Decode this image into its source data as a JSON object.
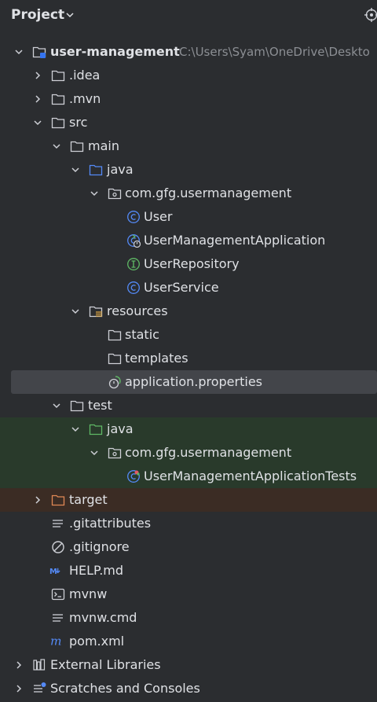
{
  "header": {
    "title": "Project"
  },
  "tree": [
    {
      "label": "user-management",
      "path": "C:\\Users\\Syam\\OneDrive\\Deskto",
      "icon": "module-folder-icon",
      "expanded": true
    },
    {
      "label": ".idea",
      "icon": "folder-icon",
      "expanded": false
    },
    {
      "label": ".mvn",
      "icon": "folder-icon",
      "expanded": false
    },
    {
      "label": "src",
      "icon": "folder-icon",
      "expanded": true
    },
    {
      "label": "main",
      "icon": "folder-icon",
      "expanded": true
    },
    {
      "label": "java",
      "icon": "source-folder-icon",
      "expanded": true
    },
    {
      "label": "com.gfg.usermanagement",
      "icon": "package-icon",
      "expanded": true
    },
    {
      "label": "User",
      "icon": "class-icon"
    },
    {
      "label": "UserManagementApplication",
      "icon": "spring-boot-class-icon"
    },
    {
      "label": "UserRepository",
      "icon": "interface-icon"
    },
    {
      "label": "UserService",
      "icon": "class-icon"
    },
    {
      "label": "resources",
      "icon": "resources-folder-icon",
      "expanded": true
    },
    {
      "label": "static",
      "icon": "folder-icon"
    },
    {
      "label": "templates",
      "icon": "folder-icon"
    },
    {
      "label": "application.properties",
      "icon": "spring-properties-icon"
    },
    {
      "label": "test",
      "icon": "folder-icon",
      "expanded": true
    },
    {
      "label": "java",
      "icon": "test-source-folder-icon",
      "expanded": true
    },
    {
      "label": "com.gfg.usermanagement",
      "icon": "package-icon",
      "expanded": true
    },
    {
      "label": "UserManagementApplicationTests",
      "icon": "test-class-icon"
    },
    {
      "label": "target",
      "icon": "excluded-folder-icon",
      "expanded": false
    },
    {
      "label": ".gitattributes",
      "icon": "text-file-icon"
    },
    {
      "label": ".gitignore",
      "icon": "ignore-file-icon"
    },
    {
      "label": "HELP.md",
      "icon": "markdown-icon"
    },
    {
      "label": "mvnw",
      "icon": "shell-script-icon"
    },
    {
      "label": "mvnw.cmd",
      "icon": "text-file-icon"
    },
    {
      "label": "pom.xml",
      "icon": "maven-icon"
    },
    {
      "label": "External Libraries",
      "icon": "libraries-icon",
      "expanded": false
    },
    {
      "label": "Scratches and Consoles",
      "icon": "scratches-icon",
      "expanded": false
    }
  ]
}
